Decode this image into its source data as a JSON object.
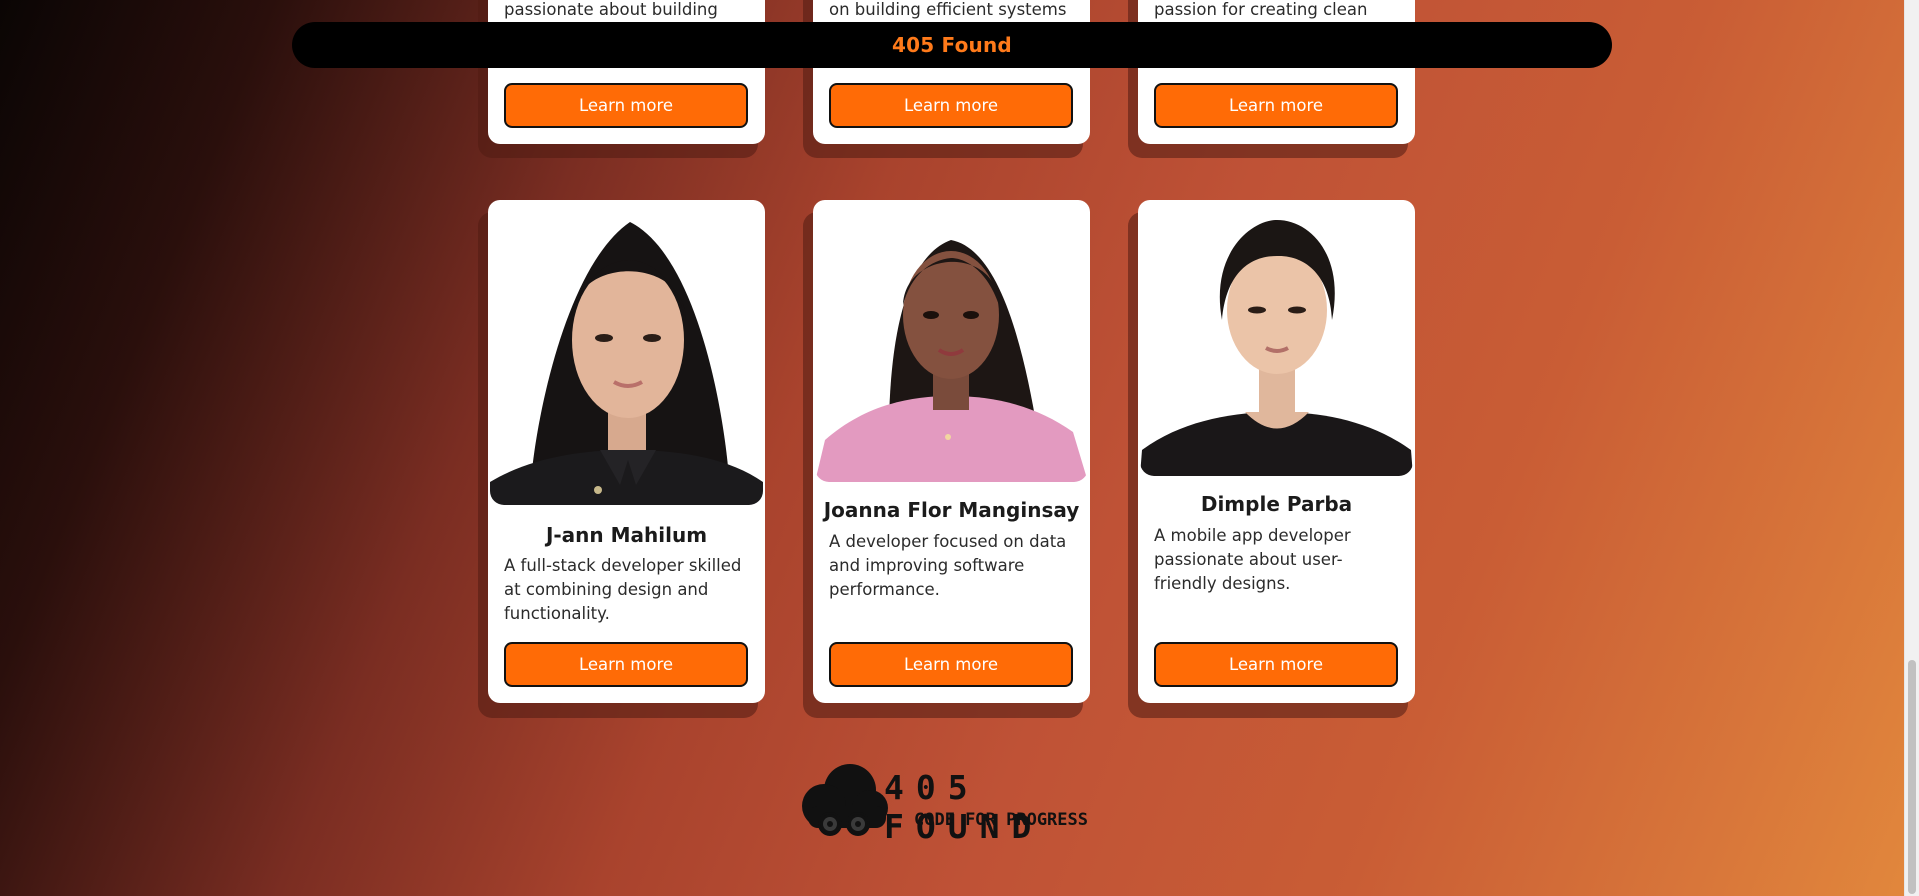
{
  "navbar": {
    "brand": "405 Found"
  },
  "top_cards": [
    {
      "snippet": "passionate about building",
      "button": "Learn more"
    },
    {
      "snippet": "on building efficient systems",
      "button": "Learn more"
    },
    {
      "snippet": "passion for creating clean",
      "button": "Learn more"
    }
  ],
  "cards": [
    {
      "name": "J-ann Mahilum",
      "description": "A full-stack developer skilled at combining design and functionality.",
      "button": "Learn more"
    },
    {
      "name": "Joanna Flor Manginsay",
      "description": "A developer focused on data and improving software performance.",
      "button": "Learn more"
    },
    {
      "name": "Dimple Parba",
      "description": "A mobile app developer passionate about user-friendly designs.",
      "button": "Learn more"
    }
  ],
  "footer": {
    "logo_title": "405 FOUND",
    "logo_tagline": "CODE FOR PROGRESS"
  },
  "colors": {
    "accent": "#ff6b06",
    "brand_text": "#ff7a1a",
    "navbar_bg": "#000000"
  }
}
